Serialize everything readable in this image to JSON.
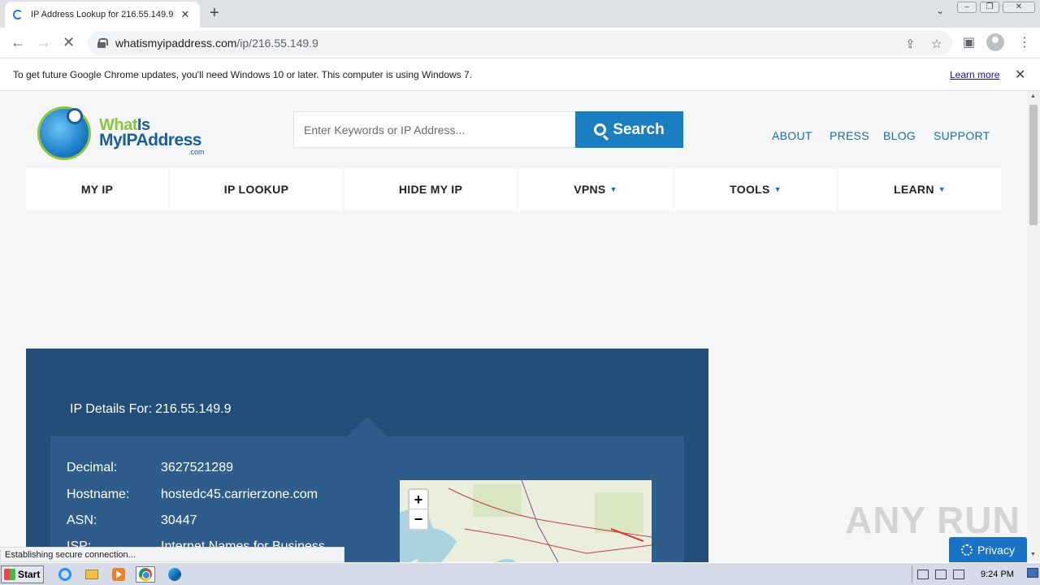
{
  "browser": {
    "tab_title": "IP Address Lookup for 216.55.149.9",
    "url_host": "whatismyipaddress.com",
    "url_path": "/ip/216.55.149.9",
    "infobar_message": "To get future Google Chrome updates, you'll need Windows 10 or later. This computer is using Windows 7.",
    "infobar_link": "Learn more",
    "status_text": "Establishing secure connection..."
  },
  "site": {
    "logo_line1_a": "What",
    "logo_line1_b": "Is",
    "logo_line2": "MyIPAddress",
    "logo_dotcom": ".com",
    "search_placeholder": "Enter Keywords or IP Address...",
    "search_button": "Search",
    "top_links": [
      "ABOUT",
      "PRESS",
      "BLOG",
      "SUPPORT"
    ],
    "nav": [
      {
        "label": "MY IP",
        "caret": ""
      },
      {
        "label": "IP LOOKUP",
        "caret": ""
      },
      {
        "label": "HIDE MY IP",
        "caret": ""
      },
      {
        "label": "VPNS",
        "caret": "▼"
      },
      {
        "label": "TOOLS",
        "caret": "▼"
      },
      {
        "label": "LEARN",
        "caret": "▼"
      }
    ],
    "ip_heading_label": "IP Details For:",
    "ip_heading_value": "216.55.149.9",
    "details": [
      {
        "key": "Decimal:",
        "value": "3627521289"
      },
      {
        "key": "Hostname:",
        "value": "hostedc45.carrierzone.com"
      },
      {
        "key": "ASN:",
        "value": "30447"
      },
      {
        "key": "ISP:",
        "value": "Internet Names for Business"
      }
    ],
    "map_zoom_in": "+",
    "map_zoom_out": "−",
    "privacy_button": "Privacy",
    "watermark": "ANY RUN"
  },
  "taskbar": {
    "start_label": "Start",
    "time": "9:24 PM"
  },
  "colors": {
    "panel": "#234e7a",
    "panel_inner": "#2e5d8b",
    "search_button": "#1a7fc1",
    "link": "#1a6fa3"
  }
}
